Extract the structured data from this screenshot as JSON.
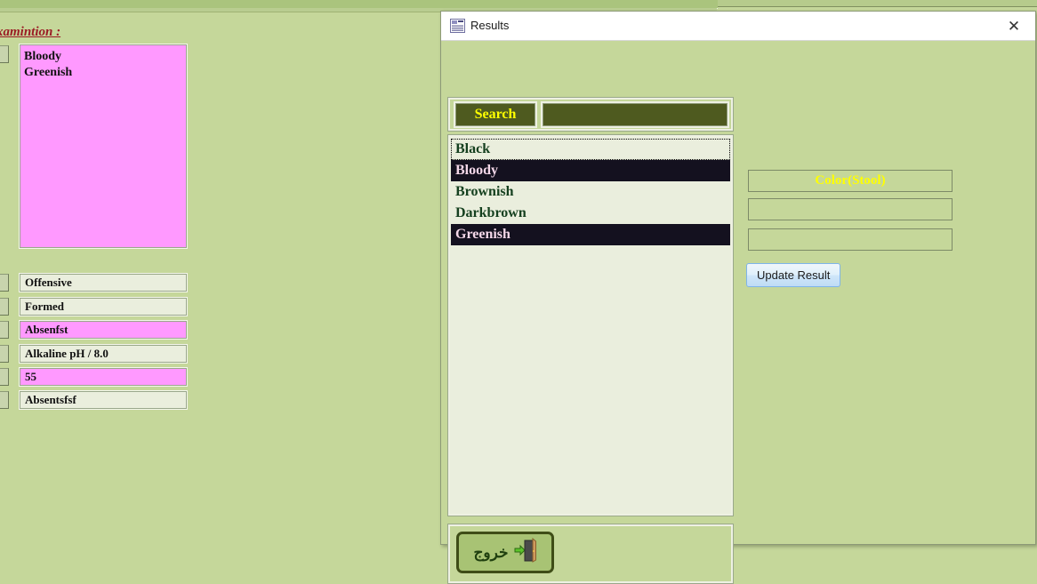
{
  "background_form": {
    "section_title": "xamintion :",
    "notes_box": {
      "lines": [
        "Bloody",
        "Greenish"
      ]
    },
    "fields": [
      {
        "value": "Offensive",
        "highlight": false
      },
      {
        "value": "Formed",
        "highlight": false
      },
      {
        "value": "Absenfst",
        "highlight": true
      },
      {
        "value": "Alkaline pH / 8.0",
        "highlight": false
      },
      {
        "value": "55",
        "highlight": true
      },
      {
        "value": "Absentsfsf",
        "highlight": false
      }
    ]
  },
  "dialog": {
    "title": "Results",
    "titlebar_icon": "form-view-icon",
    "close_icon": "close-icon",
    "search": {
      "button_label": "Search",
      "input_value": "",
      "input_placeholder": ""
    },
    "list": {
      "items": [
        {
          "label": "Black",
          "selected": false,
          "focused": true
        },
        {
          "label": "Bloody",
          "selected": true,
          "focused": false
        },
        {
          "label": "Brownish",
          "selected": false,
          "focused": false
        },
        {
          "label": "Darkbrown",
          "selected": false,
          "focused": false
        },
        {
          "label": "Greenish",
          "selected": true,
          "focused": false
        }
      ]
    },
    "result_fields": [
      {
        "value": "Color(Stool)"
      },
      {
        "value": ""
      },
      {
        "value": ""
      }
    ],
    "update_button_label": "Update Result",
    "exit": {
      "label": "خروج",
      "icon": "exit-door-icon"
    }
  },
  "colors": {
    "form_background": "#c5d79a",
    "list_background": "#eaeedd",
    "selection_background": "#14111f",
    "selection_text": "#f4d7e8",
    "accent_olive": "#4e5a1f",
    "accent_yellow": "#ffff00",
    "highlight_pink": "#ff99ff",
    "title_red": "#9b1b24"
  }
}
